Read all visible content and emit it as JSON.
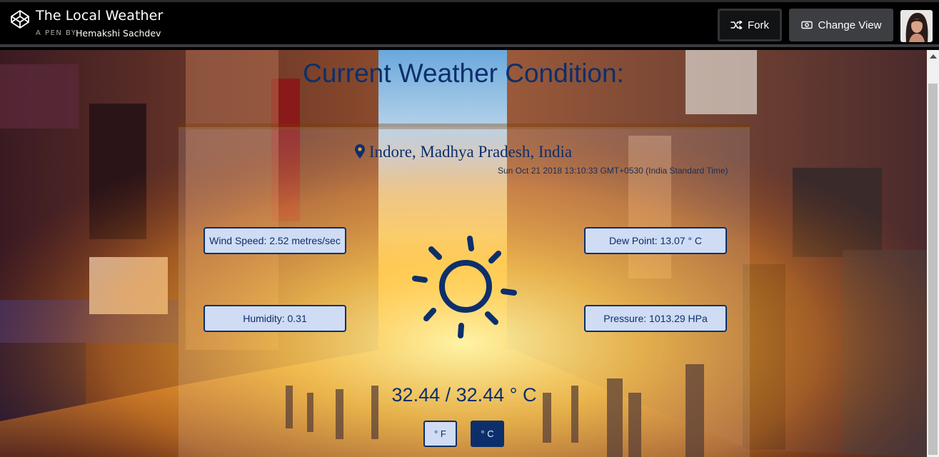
{
  "header": {
    "title": "The Local Weather",
    "by_label": "A PEN BY",
    "author": "Hemakshi Sachdev",
    "fork_label": "Fork",
    "change_view_label": "Change View"
  },
  "weather": {
    "heading": "Current Weather Condition:",
    "location": "Indore, Madhya Pradesh, India",
    "datetime": "Sun Oct 21 2018 13:10:33 GMT+0530 (India Standard Time)",
    "wind_speed": "Wind Speed: 2.52 metres/sec",
    "dew_point": "Dew Point: 13.07 ° C",
    "humidity": "Humidity: 0.31",
    "pressure": "Pressure: 1013.29 HPa",
    "temperature": "32.44 / 32.44 ° C",
    "unit_f": "° F",
    "unit_c": "° C"
  },
  "icons": [
    "codepen-logo-icon",
    "fork-icon",
    "eye-icon",
    "map-marker-icon",
    "sun-icon"
  ],
  "colors": {
    "accent": "#0c2f6c",
    "stat_bg": "#cfdcf4",
    "topbar_bg": "#000000",
    "button_bg": "#3c3e42"
  }
}
